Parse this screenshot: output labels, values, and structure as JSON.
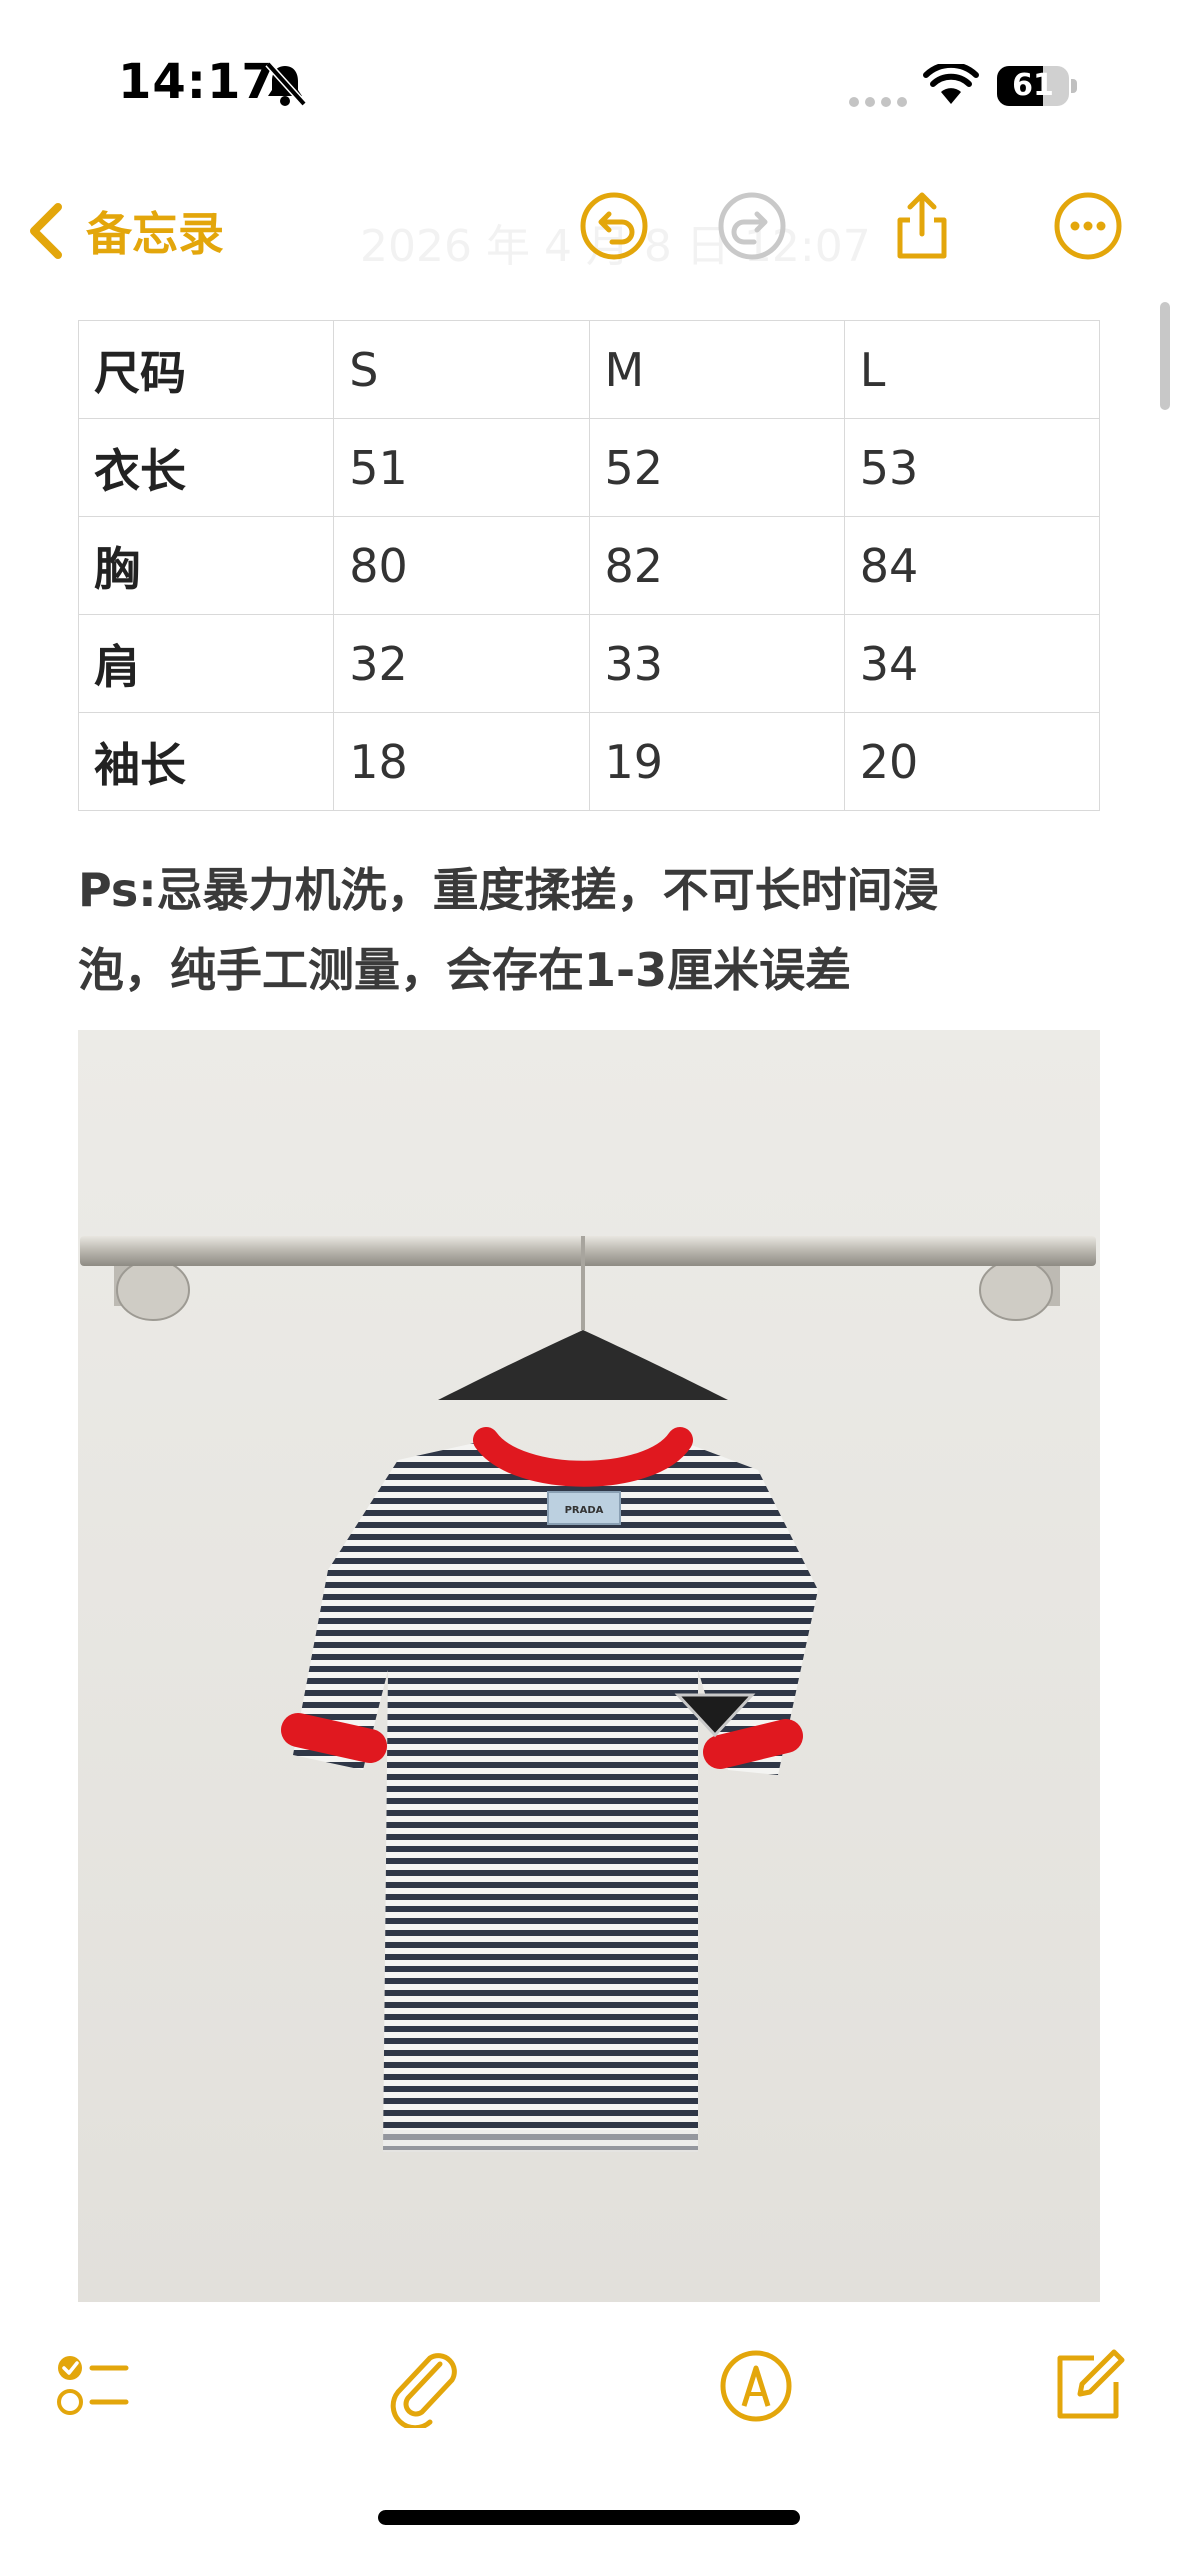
{
  "status_bar": {
    "time": "14:17",
    "battery": "61"
  },
  "nav": {
    "back_label": "备忘录",
    "ghost_date": "2026 年 4 月 8 日 12:07"
  },
  "size_table": {
    "rows": [
      [
        "尺码",
        "S",
        "M",
        "L"
      ],
      [
        "衣长",
        "51",
        "52",
        "53"
      ],
      [
        "胸",
        "80",
        "82",
        "84"
      ],
      [
        "肩",
        "32",
        "33",
        "34"
      ],
      [
        "袖长",
        "18",
        "19",
        "20"
      ]
    ]
  },
  "note": {
    "line1": "Ps:忌暴力机洗，重度揉搓，不可长时间浸",
    "line2": "泡，纯手工测量，会存在1-3厘米误差"
  },
  "photo": {
    "label_text": "PRADA"
  },
  "colors": {
    "accent": "#e3a60b",
    "collar": "#e0181f",
    "stripe": "#2f3747"
  },
  "icons": {
    "back": "chevron-left-icon",
    "undo": "undo-icon",
    "redo": "redo-icon",
    "share": "share-icon",
    "more": "more-icon",
    "checklist": "checklist-icon",
    "attach": "paperclip-icon",
    "markup": "markup-pen-icon",
    "compose": "compose-icon"
  }
}
